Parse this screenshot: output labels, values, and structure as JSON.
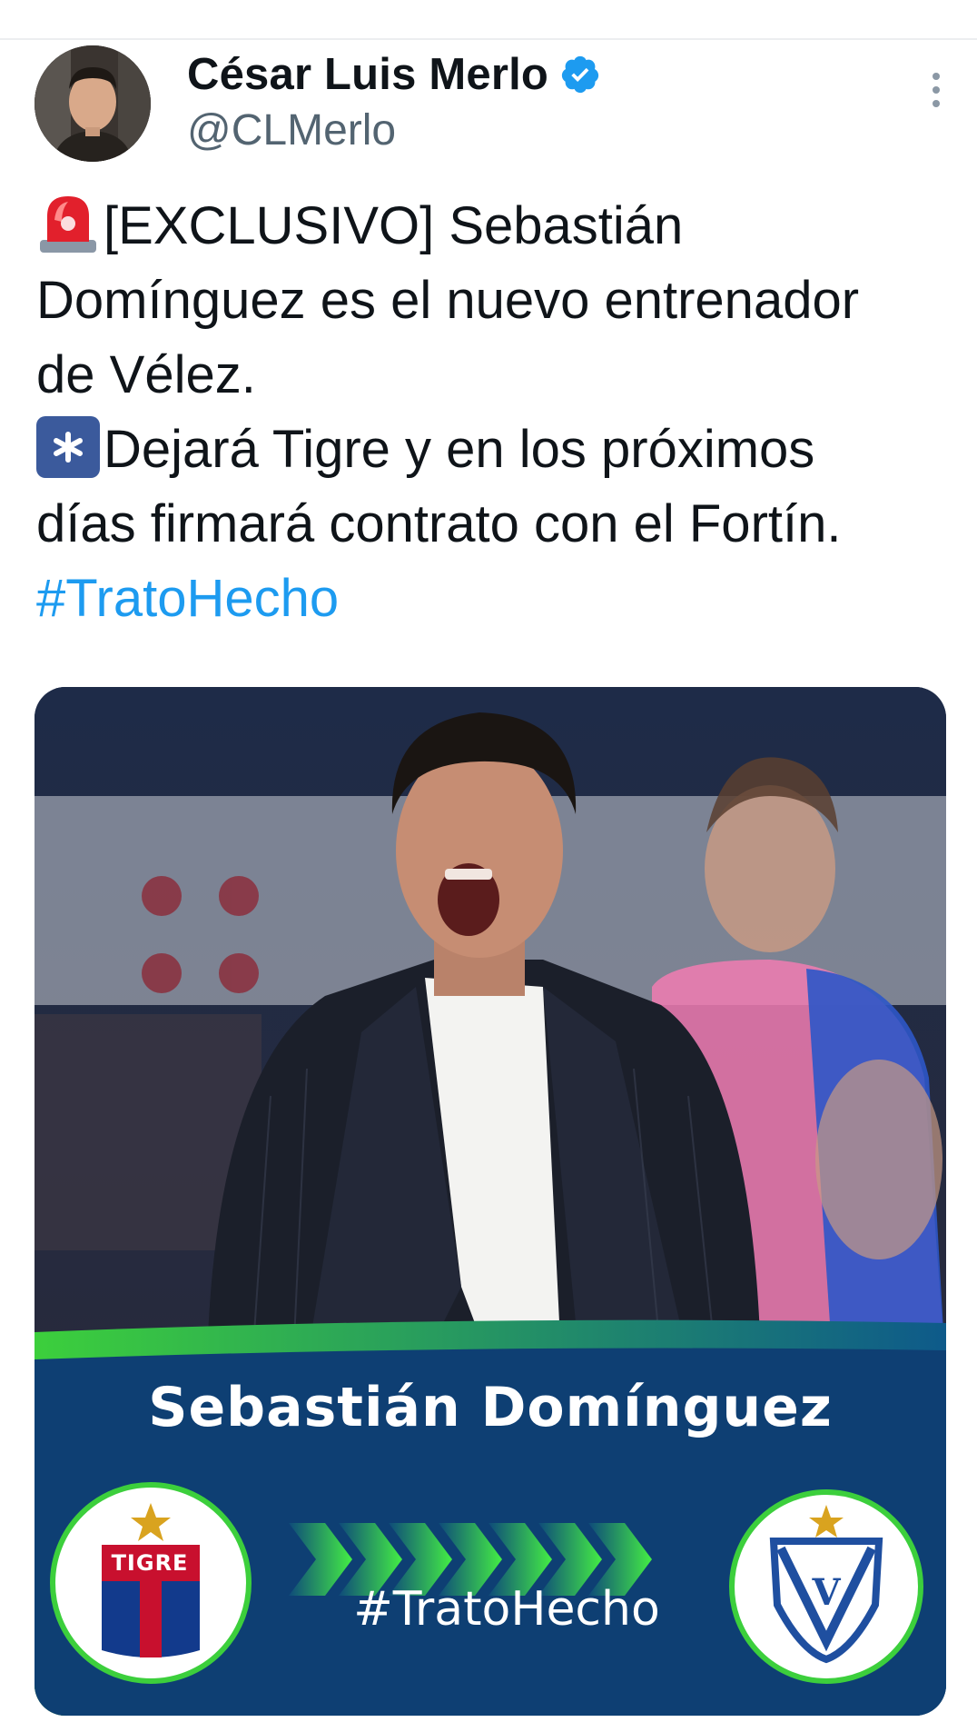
{
  "author": {
    "name": "César Luis Merlo",
    "handle": "@CLMerlo",
    "verified": true
  },
  "icons": {
    "verified": "verified-badge-icon",
    "more": "more-vertical-icon",
    "siren_emoji": "police-car-light-emoji",
    "star_emoji": "eight-spoked-asterisk-emoji"
  },
  "tweet": {
    "line1": "[EXCLUSIVO] Sebastián",
    "line2": "Domínguez es el nuevo entrenador",
    "line3": "de Vélez.",
    "line4": "Dejará Tigre y en los próximos",
    "line5": "días firmará contrato con el Fortín.",
    "hashtag": "#TratoHecho"
  },
  "media": {
    "title": "Sebastián Domínguez",
    "hashtag": "#TratoHecho",
    "from_club_word": "TIGRE"
  },
  "colors": {
    "hashtag": "#1d9bf0",
    "verified": "#1d9bf0",
    "banner_blue": "#0e3f73",
    "banner_green": "#3ccf3c"
  }
}
